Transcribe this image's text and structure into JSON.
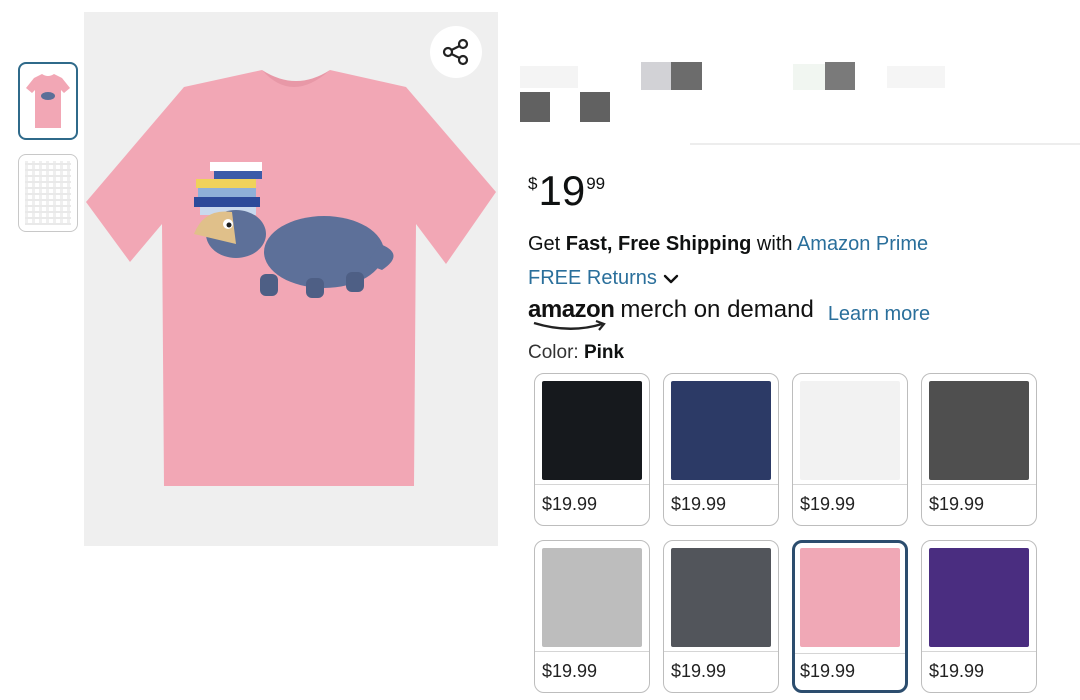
{
  "price": {
    "symbol": "$",
    "whole": "19",
    "fraction": "99"
  },
  "shipping": {
    "prefix": "Get ",
    "bold": "Fast, Free Shipping",
    "middle": " with ",
    "link": "Amazon Prime"
  },
  "returns": {
    "label": "FREE Returns"
  },
  "merch": {
    "brand": "amazon",
    "tagline": "merch on demand",
    "learn_more": "Learn more"
  },
  "color": {
    "label": "Color: ",
    "selected": "Pink"
  },
  "swatches": [
    {
      "name": "black",
      "color": "#16191d",
      "price": "$19.99"
    },
    {
      "name": "navy",
      "color": "#2c3a66",
      "price": "$19.99"
    },
    {
      "name": "white",
      "color": "#f2f2f2",
      "price": "$19.99"
    },
    {
      "name": "dark-heather",
      "color": "#4f4f4f",
      "price": "$19.99"
    },
    {
      "name": "heather-grey",
      "color": "#bdbdbd",
      "price": "$19.99"
    },
    {
      "name": "charcoal",
      "color": "#52555b",
      "price": "$19.99"
    },
    {
      "name": "pink",
      "color": "#f0a8b6",
      "price": "$19.99",
      "selected": true
    },
    {
      "name": "purple",
      "color": "#4a2d80",
      "price": "$19.99"
    }
  ],
  "colors": {
    "accent_link": "#2a6f9b",
    "selected_border": "#2c4d6e",
    "shirt": "#f2a7b5"
  },
  "icons": {
    "share": "share-icon",
    "returns_toggle": "chevron-down-icon"
  }
}
